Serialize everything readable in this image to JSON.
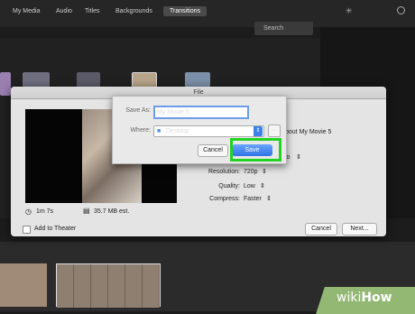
{
  "toolbar": {
    "tabs": [
      "My Media",
      "Audio",
      "Titles",
      "Backgrounds",
      "Transitions"
    ],
    "search_placeholder": "Search"
  },
  "dialog": {
    "title": "File",
    "about_text": "bout My Movie 5",
    "duration": "1m 7s",
    "file_size": "35.7 MB est.",
    "format_partial": "io",
    "resolution_label": "Resolution:",
    "resolution_value": "720p",
    "quality_label": "Quality:",
    "quality_value": "Low",
    "compress_label": "Compress:",
    "compress_value": "Faster",
    "add_to_theater_label": "Add to Theater",
    "cancel_label": "Cancel",
    "next_label": "Next..."
  },
  "save_sheet": {
    "save_as_label": "Save As:",
    "save_as_value": "My Movie 5",
    "where_label": "Where:",
    "where_value": "Desktop",
    "cancel_label": "Cancel",
    "save_label": "Save"
  },
  "watermark": {
    "brand_wiki": "wiki",
    "brand_how": "How"
  },
  "colors": {
    "highlight": "#22d322",
    "accent": "#2f73e5",
    "watermark_green": "#93b874"
  }
}
